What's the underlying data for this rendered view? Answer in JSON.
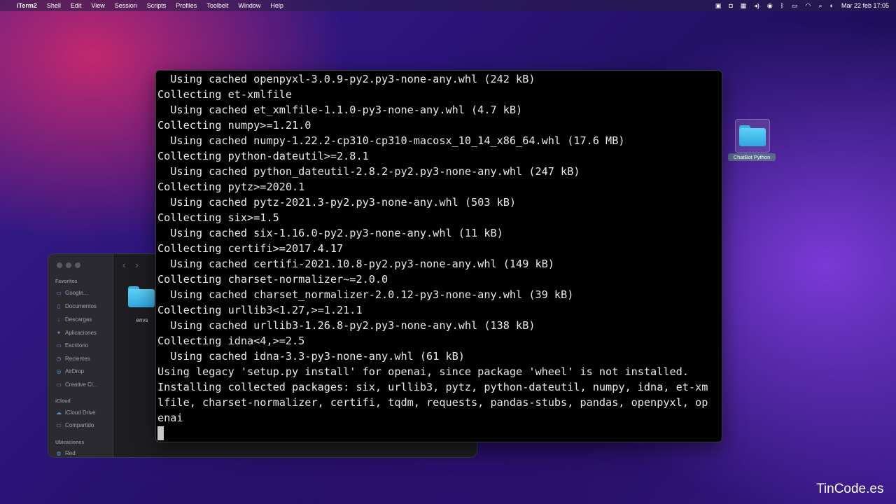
{
  "menubar": {
    "app_name": "iTerm2",
    "items": [
      "Shell",
      "Edit",
      "View",
      "Session",
      "Scripts",
      "Profiles",
      "Toolbelt",
      "Window",
      "Help"
    ],
    "datetime": "Mar 22 feb  17:05"
  },
  "terminal": {
    "lines": [
      "  Using cached openpyxl-3.0.9-py2.py3-none-any.whl (242 kB)",
      "Collecting et-xmlfile",
      "  Using cached et_xmlfile-1.1.0-py3-none-any.whl (4.7 kB)",
      "Collecting numpy>=1.21.0",
      "  Using cached numpy-1.22.2-cp310-cp310-macosx_10_14_x86_64.whl (17.6 MB)",
      "Collecting python-dateutil>=2.8.1",
      "  Using cached python_dateutil-2.8.2-py2.py3-none-any.whl (247 kB)",
      "Collecting pytz>=2020.1",
      "  Using cached pytz-2021.3-py2.py3-none-any.whl (503 kB)",
      "Collecting six>=1.5",
      "  Using cached six-1.16.0-py2.py3-none-any.whl (11 kB)",
      "Collecting certifi>=2017.4.17",
      "  Using cached certifi-2021.10.8-py2.py3-none-any.whl (149 kB)",
      "Collecting charset-normalizer~=2.0.0",
      "  Using cached charset_normalizer-2.0.12-py3-none-any.whl (39 kB)",
      "Collecting urllib3<1.27,>=1.21.1",
      "  Using cached urllib3-1.26.8-py2.py3-none-any.whl (138 kB)",
      "Collecting idna<4,>=2.5",
      "  Using cached idna-3.3-py3-none-any.whl (61 kB)",
      "Using legacy 'setup.py install' for openai, since package 'wheel' is not installed.",
      "Installing collected packages: six, urllib3, pytz, python-dateutil, numpy, idna, et-xm",
      "lfile, charset-normalizer, certifi, tqdm, requests, pandas-stubs, pandas, openpyxl, op",
      "enai"
    ]
  },
  "finder": {
    "section_favorites": "Favoritos",
    "favorites": [
      "Google...",
      "Documentos",
      "Descargas",
      "Aplicaciones",
      "Escritorio",
      "Recientes",
      "AirDrop",
      "Creative Cl..."
    ],
    "section_icloud": "iCloud",
    "icloud": [
      "iCloud Drive",
      "Compartido"
    ],
    "section_locations": "Ubicaciones",
    "locations": [
      "Red"
    ],
    "folder_label": "envs"
  },
  "desktop": {
    "folder_label": "ChatBot Python"
  },
  "watermark": "TinCode.es"
}
